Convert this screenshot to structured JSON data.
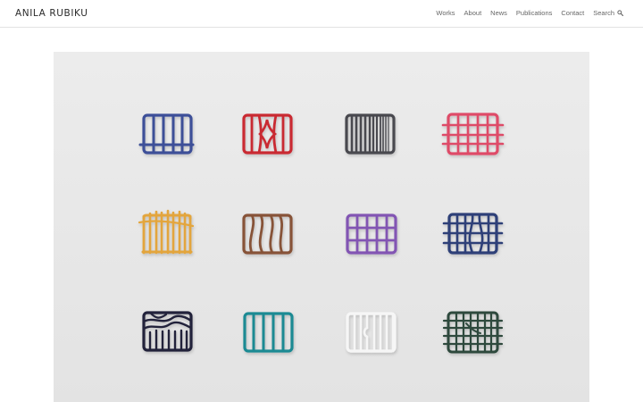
{
  "site": {
    "title": "ANILA RUBIKU"
  },
  "nav": {
    "items": [
      {
        "label": "Works"
      },
      {
        "label": "About"
      },
      {
        "label": "News"
      },
      {
        "label": "Publications"
      },
      {
        "label": "Contact"
      }
    ],
    "search_label": "Search",
    "search_icon": "search-icon"
  },
  "artwork": {
    "colors": {
      "blue": "#3e4f98",
      "red": "#c92a33",
      "charcoal": "#4a4a4f",
      "pink": "#de4b68",
      "mustard": "#e3a53c",
      "brown": "#875238",
      "purple": "#8255b3",
      "navy": "#2e3f78",
      "black": "#23233a",
      "teal": "#1f8a93",
      "white": "#f6f6f6",
      "green": "#2e4a3e"
    }
  }
}
